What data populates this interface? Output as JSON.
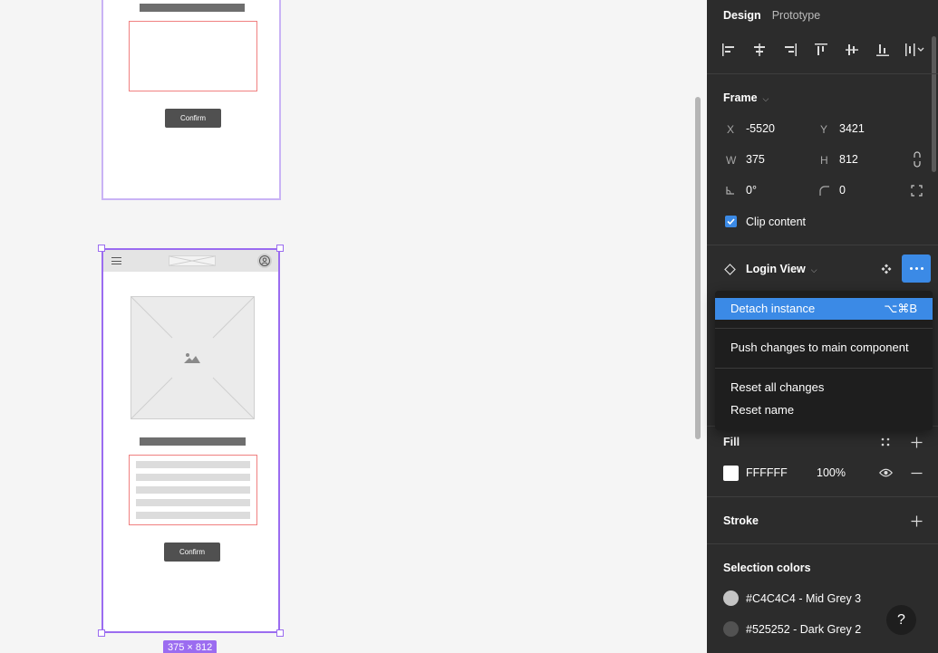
{
  "canvas": {
    "top_frame": {
      "confirm_label": "Confirm"
    },
    "bottom_frame": {
      "confirm_label": "Confirm"
    },
    "size_label": "375 × 812"
  },
  "panel": {
    "tabs": [
      {
        "label": "Design",
        "active": true
      },
      {
        "label": "Prototype",
        "active": false
      }
    ],
    "frame": {
      "title": "Frame",
      "x_label": "X",
      "x_value": "-5520",
      "y_label": "Y",
      "y_value": "3421",
      "w_label": "W",
      "w_value": "375",
      "h_label": "H",
      "h_value": "812",
      "rotation_value": "0°",
      "radius_value": "0",
      "clip_content_label": "Clip content",
      "clip_content_checked": true
    },
    "instance": {
      "name": "Login View"
    },
    "fill": {
      "title": "Fill",
      "hex": "FFFFFF",
      "opacity": "100%",
      "color": "#FFFFFF"
    },
    "stroke": {
      "title": "Stroke"
    },
    "selection_colors": {
      "title": "Selection colors",
      "items": [
        {
          "label": "#C4C4C4 - Mid Grey 3",
          "color": "#C4C4C4"
        },
        {
          "label": "#525252 - Dark Grey 2",
          "color": "#525252"
        }
      ]
    }
  },
  "menu": {
    "items": [
      {
        "label": "Detach instance",
        "shortcut": "⌥⌘B",
        "highlighted": true
      },
      {
        "label": "Push changes to main component",
        "shortcut": ""
      },
      {
        "label": "Reset all changes",
        "shortcut": ""
      },
      {
        "label": "Reset name",
        "shortcut": ""
      }
    ]
  },
  "help": {
    "label": "?"
  },
  "colors": {
    "accent": "#3B8AE6",
    "selection": "#9B6CF0",
    "panel_bg": "#2C2C2C"
  }
}
